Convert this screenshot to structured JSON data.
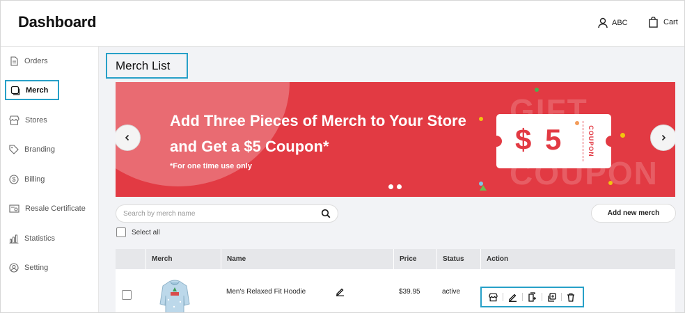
{
  "header": {
    "logo": "Dashboard",
    "user_label": "ABC",
    "cart_label": "Cart"
  },
  "sidebar": {
    "items": [
      {
        "label": "Orders",
        "icon": "document-icon"
      },
      {
        "label": "Merch",
        "icon": "merch-icon",
        "active": true
      },
      {
        "label": "Stores",
        "icon": "store-icon"
      },
      {
        "label": "Branding",
        "icon": "tag-icon"
      },
      {
        "label": "Billing",
        "icon": "dollar-icon"
      },
      {
        "label": "Resale Certificate",
        "icon": "certificate-icon"
      },
      {
        "label": "Statistics",
        "icon": "chart-icon"
      },
      {
        "label": "Setting",
        "icon": "user-setting-icon"
      }
    ]
  },
  "page": {
    "title": "Merch List"
  },
  "banner": {
    "headline": "Add Three Pieces of Merch to Your Store and Get a $5 Coupon*",
    "note": "*For one time use only",
    "coupon_amount": "$ 5",
    "coupon_label": "COUPON",
    "bg_text_1": "GIFT",
    "bg_text_2": "COUPON",
    "prev_icon": "chevron-left-icon",
    "next_icon": "chevron-right-icon",
    "color": "#e23a43"
  },
  "toolbar": {
    "search_placeholder": "Search by merch name",
    "search_value": "",
    "add_button": "Add new merch",
    "select_all": "Select all"
  },
  "table": {
    "columns": [
      "Merch",
      "Name",
      "Price",
      "Status",
      "Action"
    ],
    "rows": [
      {
        "name": "Men's Relaxed Fit Hoodie",
        "price": "$39.95",
        "status": "active",
        "actions": [
          "store-icon",
          "edit-icon",
          "duplicate-icon",
          "copy-icon",
          "delete-icon"
        ]
      }
    ]
  },
  "colors": {
    "accent": "#27a0c8",
    "banner_red": "#e23a43"
  }
}
